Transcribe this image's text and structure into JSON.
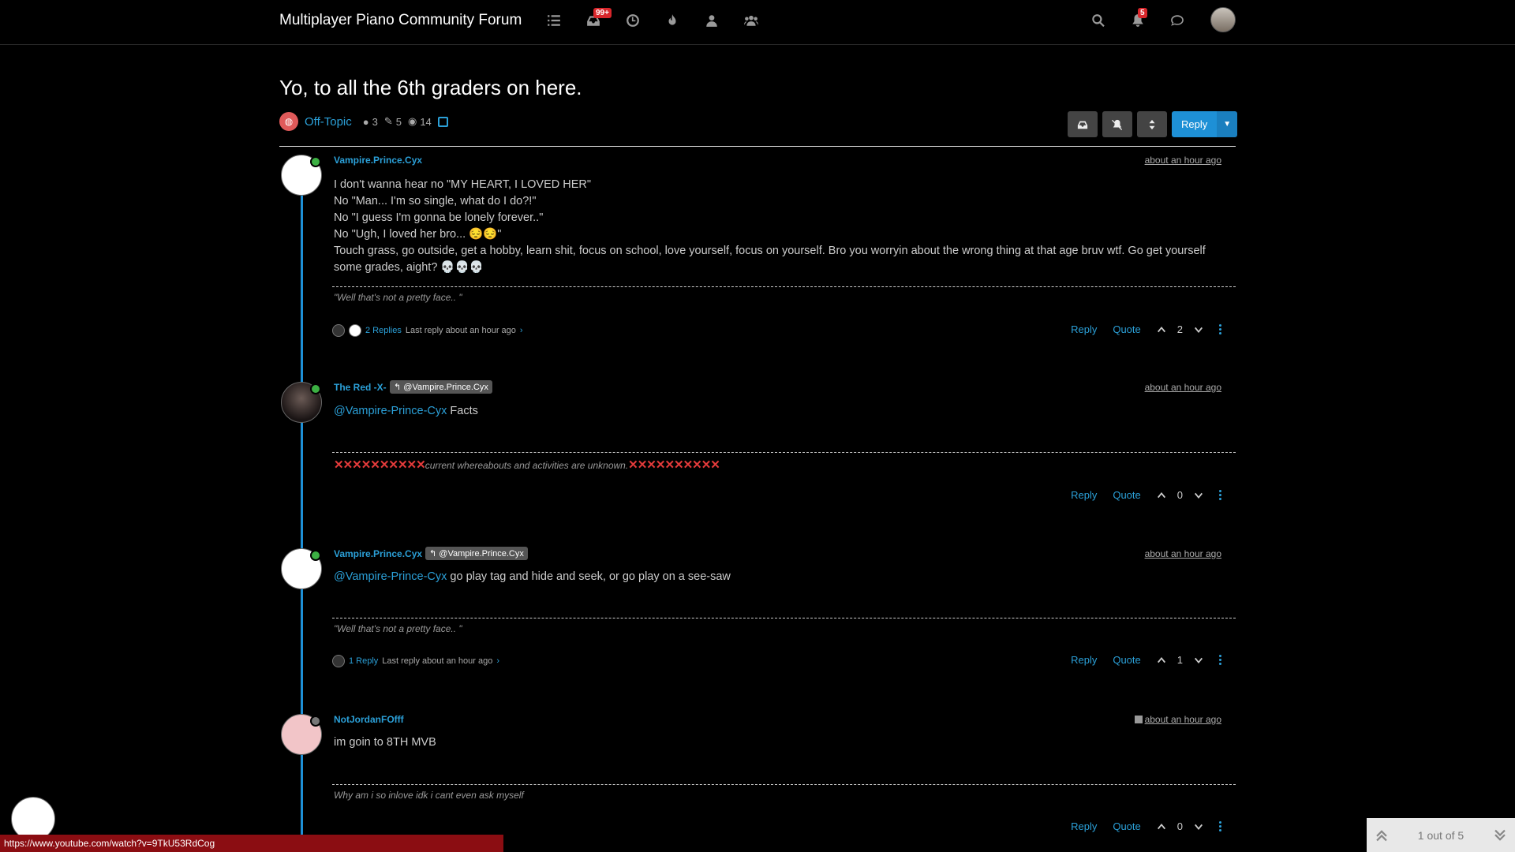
{
  "nav": {
    "brand": "Multiplayer Piano Community Forum",
    "unread_badge": "99+",
    "notif_badge": "5"
  },
  "topic": {
    "title": "Yo, to all the 6th graders on here.",
    "category": "Off-Topic",
    "posters": "3",
    "posts": "5",
    "views": "14",
    "reply_label": "Reply"
  },
  "posts": [
    {
      "author": "Vampire.Prince.Cyx",
      "time": "about an hour ago",
      "lines": [
        "I don't wanna hear no \"MY HEART, I LOVED HER\"",
        "No \"Man... I'm so single, what do I do?!\"",
        "No \"I guess I'm gonna be lonely forever..\"",
        "No \"Ugh, I loved her bro... 😔😔\"",
        "Touch grass, go outside, get a hobby, learn shit, focus on school, love yourself, focus on yourself. Bro you worryin about the wrong thing at that age bruv wtf. Go get yourself some grades, aight? 💀💀💀"
      ],
      "signature": "\"Well that's not a pretty face.. \"",
      "replies": "2 Replies",
      "last_reply": "Last reply about an hour ago",
      "votes": "2"
    },
    {
      "author": "The Red -X-",
      "reply_to": "@Vampire.Prince.Cyx",
      "time": "about an hour ago",
      "mention": "@Vampire-Prince-Cyx",
      "text": "Facts",
      "sig_marks_left": "✕✕✕✕✕✕✕✕✕✕",
      "signature": "current whereabouts and activities are unknown.",
      "sig_marks_right": "✕✕✕✕✕✕✕✕✕✕",
      "votes": "0"
    },
    {
      "author": "Vampire.Prince.Cyx",
      "reply_to": "@Vampire.Prince.Cyx",
      "time": "about an hour ago",
      "mention": "@Vampire-Prince-Cyx",
      "text": "go play tag and hide and seek, or go play on a see-saw",
      "signature": "\"Well that's not a pretty face.. \"",
      "replies": "1 Reply",
      "last_reply": "Last reply about an hour ago",
      "votes": "1"
    },
    {
      "author": "NotJordanFOfff",
      "time": "about an hour ago",
      "text": "im goin to 8TH MVB",
      "signature": "Why am i so inlove idk i cant even ask myself",
      "votes": "0"
    }
  ],
  "action_labels": {
    "reply": "Reply",
    "quote": "Quote"
  },
  "status_url": "https://www.youtube.com/watch?v=9TkU53RdCog",
  "pagination": "1 out of 5"
}
